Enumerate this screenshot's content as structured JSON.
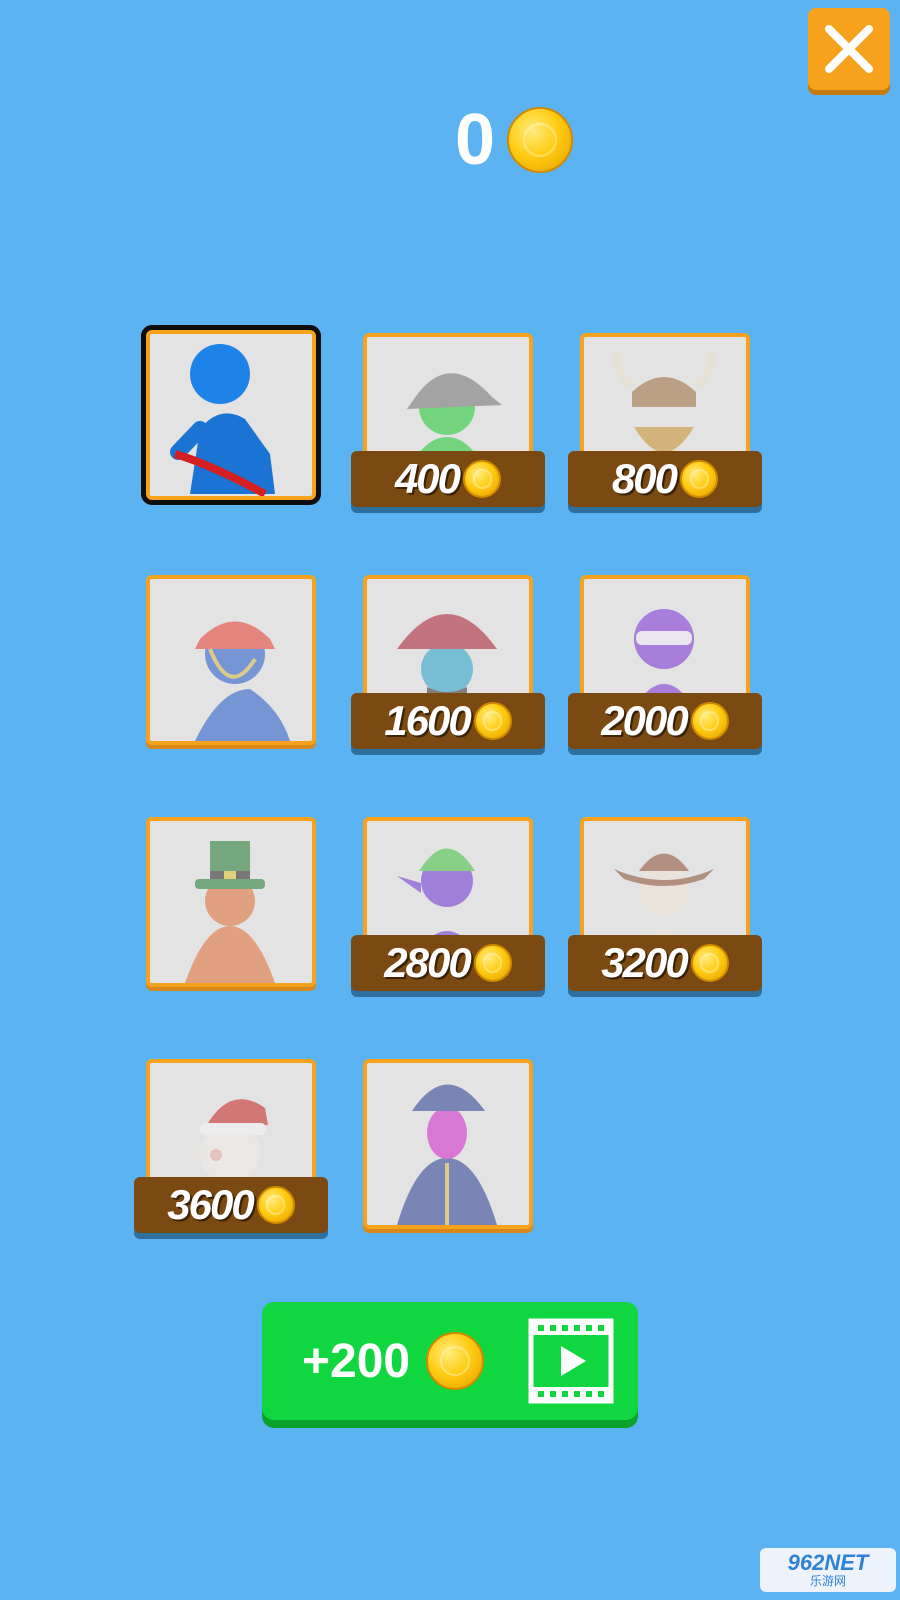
{
  "header": {
    "coin_count": "0",
    "close_icon": "close-icon"
  },
  "skins": [
    {
      "name": "blue-stickman",
      "price": "",
      "state": "selected"
    },
    {
      "name": "firefighter",
      "price": "400",
      "state": "locked"
    },
    {
      "name": "viking",
      "price": "800",
      "state": "locked"
    },
    {
      "name": "pirate-bandana",
      "price": "",
      "state": "owned"
    },
    {
      "name": "pirate-captain",
      "price": "1600",
      "state": "locked"
    },
    {
      "name": "ninja",
      "price": "2000",
      "state": "locked"
    },
    {
      "name": "leprechaun",
      "price": "",
      "state": "owned"
    },
    {
      "name": "goblin",
      "price": "2800",
      "state": "locked"
    },
    {
      "name": "cowboy",
      "price": "3200",
      "state": "locked"
    },
    {
      "name": "santa",
      "price": "3600",
      "state": "locked"
    },
    {
      "name": "wizard",
      "price": "",
      "state": "owned"
    }
  ],
  "reward_button": {
    "amount": "+200",
    "icon": "video-play-icon"
  },
  "watermark": {
    "top": "962NET",
    "bottom": "乐游网"
  },
  "colors": {
    "background": "#5bb4f1",
    "accent": "#f6a21d",
    "price_tag": "#7a4a12",
    "reward_green": "#10d63f",
    "coin": "#ffcd12"
  }
}
